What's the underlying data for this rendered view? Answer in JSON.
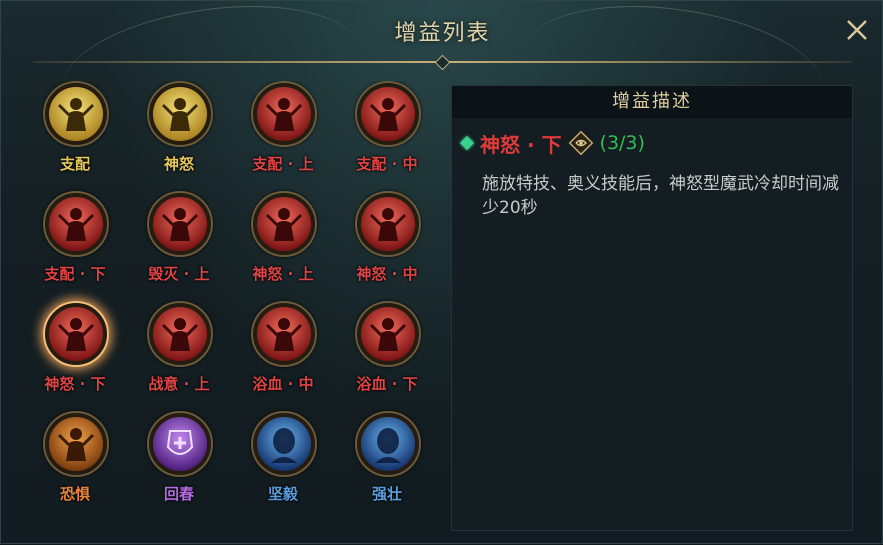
{
  "window": {
    "title": "增益列表",
    "close_icon": "close-icon"
  },
  "buffs": [
    {
      "id": "zhipei",
      "label": "支配",
      "color": "#e6c85a",
      "theme": "gold"
    },
    {
      "id": "shennu",
      "label": "神怒",
      "color": "#e6c85a",
      "theme": "gold"
    },
    {
      "id": "zhipei-shang",
      "label": "支配 · 上",
      "color": "#e04444",
      "theme": "red"
    },
    {
      "id": "zhipei-zhong",
      "label": "支配 · 中",
      "color": "#e04444",
      "theme": "red"
    },
    {
      "id": "zhipei-xia",
      "label": "支配 · 下",
      "color": "#e04444",
      "theme": "red"
    },
    {
      "id": "huimie-shang",
      "label": "毁灭 · 上",
      "color": "#e04444",
      "theme": "red"
    },
    {
      "id": "shennu-shang",
      "label": "神怒 · 上",
      "color": "#e04444",
      "theme": "red"
    },
    {
      "id": "shennu-zhong",
      "label": "神怒 · 中",
      "color": "#e04444",
      "theme": "red"
    },
    {
      "id": "shennu-xia",
      "label": "神怒 · 下",
      "color": "#e04444",
      "theme": "red",
      "selected": true
    },
    {
      "id": "zhanyi-shang",
      "label": "战意 · 上",
      "color": "#e04444",
      "theme": "red"
    },
    {
      "id": "yuxue-zhong",
      "label": "浴血 · 中",
      "color": "#e04444",
      "theme": "red"
    },
    {
      "id": "yuxue-xia",
      "label": "浴血 · 下",
      "color": "#e04444",
      "theme": "red"
    },
    {
      "id": "kongju",
      "label": "恐惧",
      "color": "#e8843a",
      "theme": "orange"
    },
    {
      "id": "huichun",
      "label": "回春",
      "color": "#b56be0",
      "theme": "purple"
    },
    {
      "id": "jianyi",
      "label": "坚毅",
      "color": "#5a9ee0",
      "theme": "blue"
    },
    {
      "id": "qiangzhuang",
      "label": "强壮",
      "color": "#5a9ee0",
      "theme": "blue"
    }
  ],
  "description": {
    "header": "增益描述",
    "name": "神怒 · 下",
    "stack": "(3/3)",
    "text": "施放特技、奥义技能后，神怒型魔武冷却时间减少20秒",
    "gem_icon": "gem-icon",
    "badge_icon": "rune-badge-icon"
  }
}
